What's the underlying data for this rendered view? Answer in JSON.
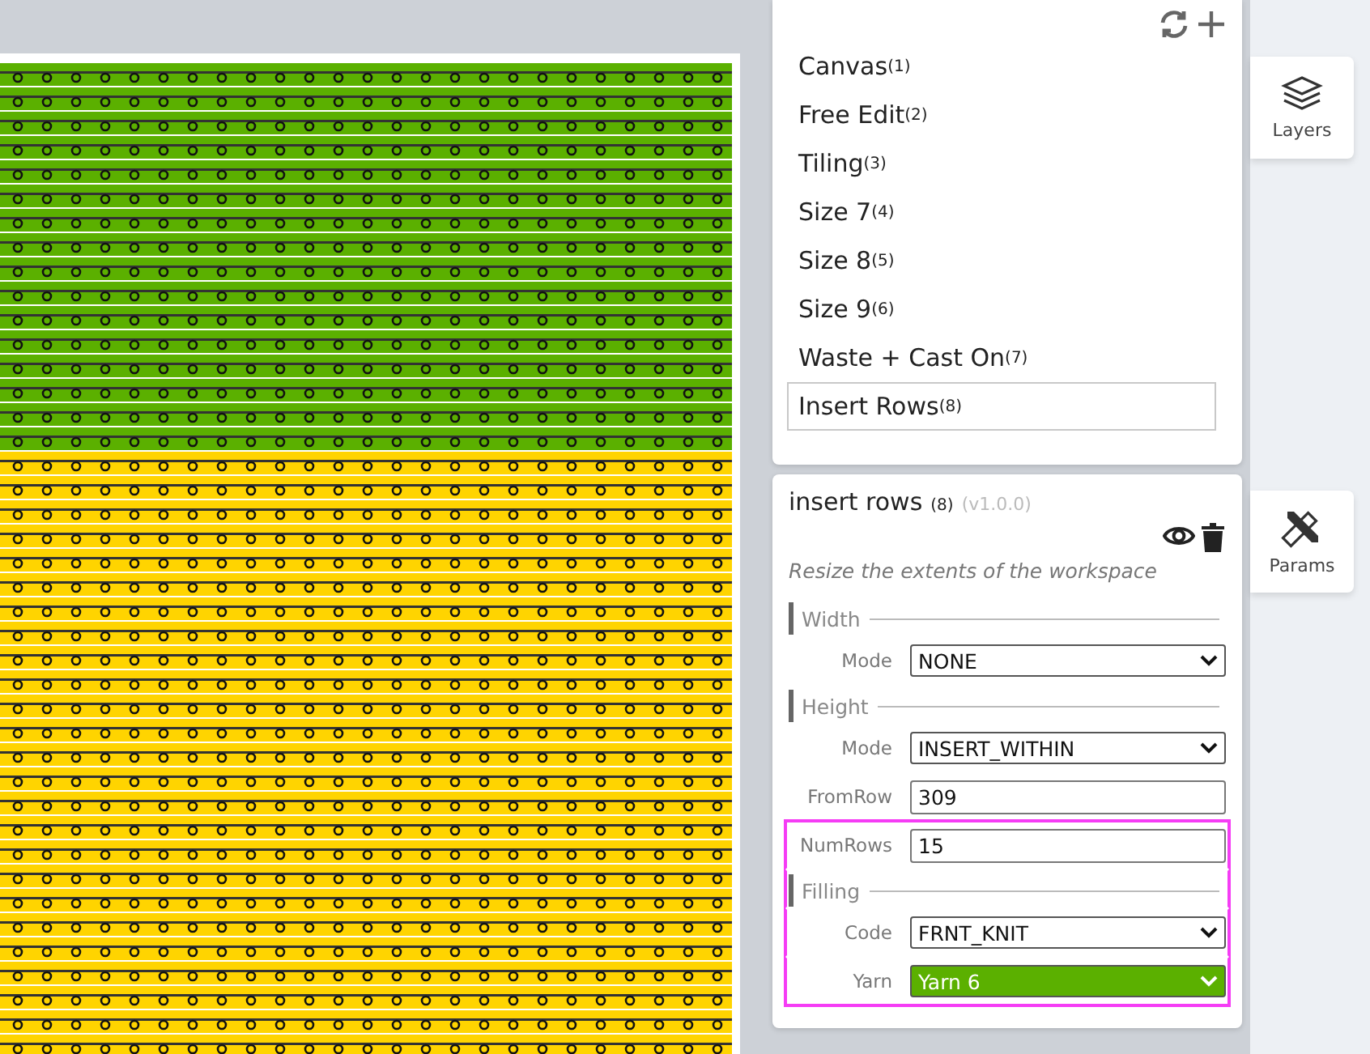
{
  "layers": [
    {
      "name": "Canvas",
      "index": "(1)",
      "selected": false
    },
    {
      "name": "Free Edit",
      "index": "(2)",
      "selected": false
    },
    {
      "name": "Tiling",
      "index": "(3)",
      "selected": false
    },
    {
      "name": "Size 7",
      "index": "(4)",
      "selected": false
    },
    {
      "name": "Size 8",
      "index": "(5)",
      "selected": false
    },
    {
      "name": "Size 9",
      "index": "(6)",
      "selected": false
    },
    {
      "name": "Waste + Cast On",
      "index": "(7)",
      "selected": false
    },
    {
      "name": "Insert Rows",
      "index": "(8)",
      "selected": true
    }
  ],
  "side_tabs": [
    {
      "label": "Layers",
      "kind": "layers"
    },
    {
      "label": "Params",
      "kind": "params"
    }
  ],
  "params": {
    "title": "insert rows",
    "index": "(8)",
    "version": "(v1.0.0)",
    "description": "Resize the extents of the workspace",
    "items": [
      {
        "kind": "heading",
        "label": "Width",
        "highlighted": false
      },
      {
        "kind": "select",
        "label": "Mode",
        "value": "NONE",
        "highlighted": false
      },
      {
        "kind": "heading",
        "label": "Height",
        "highlighted": false
      },
      {
        "kind": "select",
        "label": "Mode",
        "value": "INSERT_WITHIN",
        "highlighted": false
      },
      {
        "kind": "input",
        "label": "FromRow",
        "value": "309",
        "highlighted": false
      },
      {
        "kind": "input",
        "label": "NumRows",
        "value": "15",
        "highlighted": true
      },
      {
        "kind": "heading",
        "label": "Filling",
        "highlighted": true
      },
      {
        "kind": "select",
        "label": "Code",
        "value": "FRNT_KNIT",
        "highlighted": true
      },
      {
        "kind": "select",
        "label": "Yarn",
        "value": "Yarn 6",
        "color": "#5bb000",
        "highlighted": true
      }
    ]
  }
}
